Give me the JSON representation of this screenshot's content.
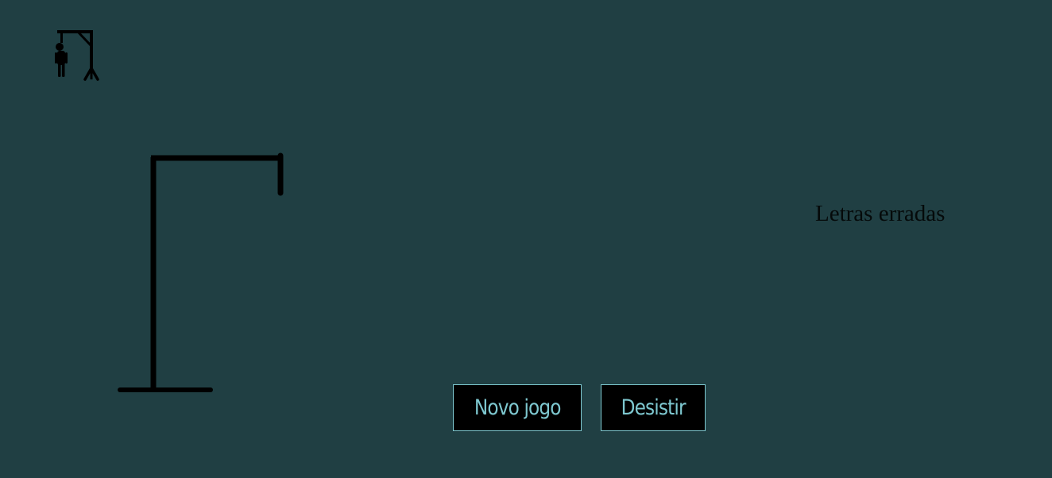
{
  "logo": {
    "icon": "hangman-icon"
  },
  "game": {
    "gallows_icon": "gallows",
    "stroke_color": "#000000",
    "wrong_letters_title": "Letras erradas",
    "wrong_letters": ""
  },
  "buttons": {
    "new_game": "Novo jogo",
    "give_up": "Desistir"
  },
  "colors": {
    "background": "#203f43",
    "button_text": "#7ec8d0",
    "button_border": "#7ec8d0",
    "button_bg": "#000000"
  }
}
